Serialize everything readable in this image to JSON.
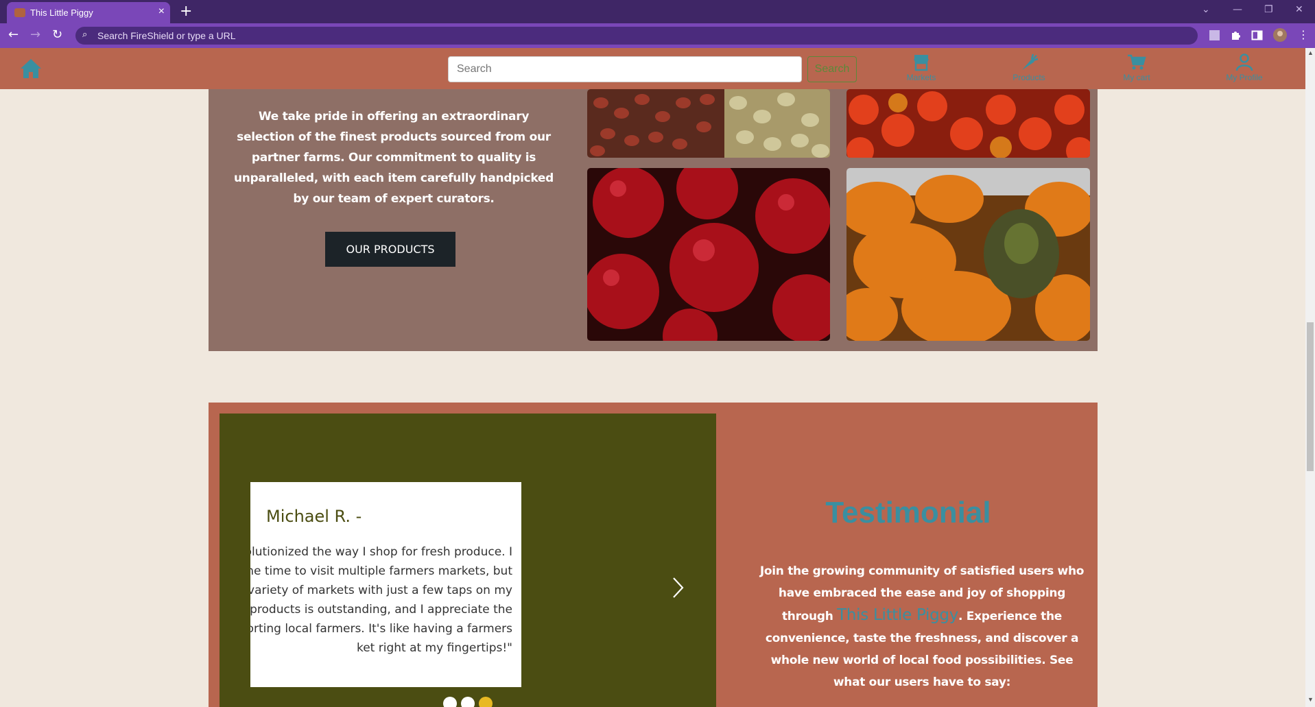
{
  "browser": {
    "tab_title": "This Little Piggy",
    "tab_close": "×",
    "new_tab": "+",
    "omnibox_placeholder": "Search FireShield or type a URL"
  },
  "nav": {
    "search_placeholder": "Search",
    "search_button": "Search",
    "items": [
      {
        "label": "Markets",
        "icon": "store-icon"
      },
      {
        "label": "Products",
        "icon": "carrot-icon"
      },
      {
        "label": "My cart",
        "icon": "cart-icon"
      },
      {
        "label": "My Profile",
        "icon": "person-icon"
      }
    ]
  },
  "intro": {
    "text": "We take pride in offering an extraordinary selection of the finest products sourced from our partner farms. Our commitment to quality is unparalleled, with each item carefully handpicked by our team of expert curators.",
    "button": "OUR PRODUCTS"
  },
  "testimonial": {
    "name": "Michael R. -",
    "quote_lines": [
      "volutionized the way I shop for fresh produce. I",
      "the time to visit multiple farmers markets, but",
      "a variety of markets with just a few taps on my",
      "e products is outstanding, and I appreciate the",
      "pporting local farmers. It's like having a farmers",
      "ket right at my fingertips!\""
    ],
    "title": "Testimonial",
    "text_before": "Join the growing community of satisfied users who have embraced the ease and joy of shopping through ",
    "brand": "This Little Piggy",
    "text_after": ". Experience the convenience, taste the freshness, and discover a whole new world of local food possibilities. See what our users have to say:",
    "dots_active_index": 2
  },
  "colors": {
    "nav_bg": "#b8664f",
    "accent_teal": "#3a8fa0",
    "intro_bg": "#8e6f66",
    "olive": "#4b4d12",
    "page_bg": "#f0e8de",
    "dot_active": "#e8b923"
  }
}
